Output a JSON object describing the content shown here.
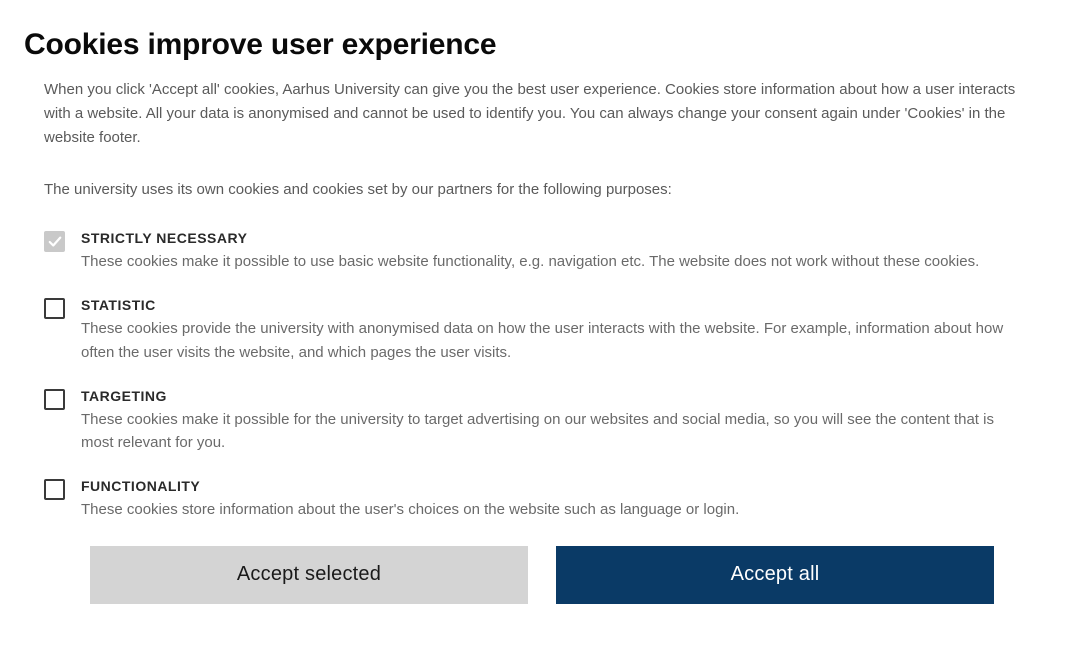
{
  "title": "Cookies improve user experience",
  "intro": "When you click 'Accept all' cookies, Aarhus University can give you the best user experience. Cookies store information about how a user interacts with a website. All your data is anonymised and cannot be used to identify you. You can always change your consent again under 'Cookies' in the website footer.",
  "subintro": "The university uses its own cookies and cookies set by our partners for the following purposes:",
  "categories": {
    "strictly_necessary": {
      "title": "STRICTLY NECESSARY",
      "desc": "These cookies make it possible to use basic website functionality, e.g. navigation etc. The website does not work without these cookies.",
      "checked": true,
      "disabled": true
    },
    "statistic": {
      "title": "STATISTIC",
      "desc": "These cookies provide the university with anonymised data on how the user interacts with the website. For example, information about how often the user visits the website, and which pages the user visits.",
      "checked": false,
      "disabled": false
    },
    "targeting": {
      "title": "TARGETING",
      "desc": "These cookies make it possible for the university to target advertising on our websites and social media, so you will see the content that is most relevant for you.",
      "checked": false,
      "disabled": false
    },
    "functionality": {
      "title": "FUNCTIONALITY",
      "desc": "These cookies store information about the user's choices on the website such as language or login.",
      "checked": false,
      "disabled": false
    }
  },
  "buttons": {
    "accept_selected": "Accept selected",
    "accept_all": "Accept all"
  },
  "colors": {
    "primary": "#0a3a66",
    "secondary": "#d4d4d4"
  }
}
